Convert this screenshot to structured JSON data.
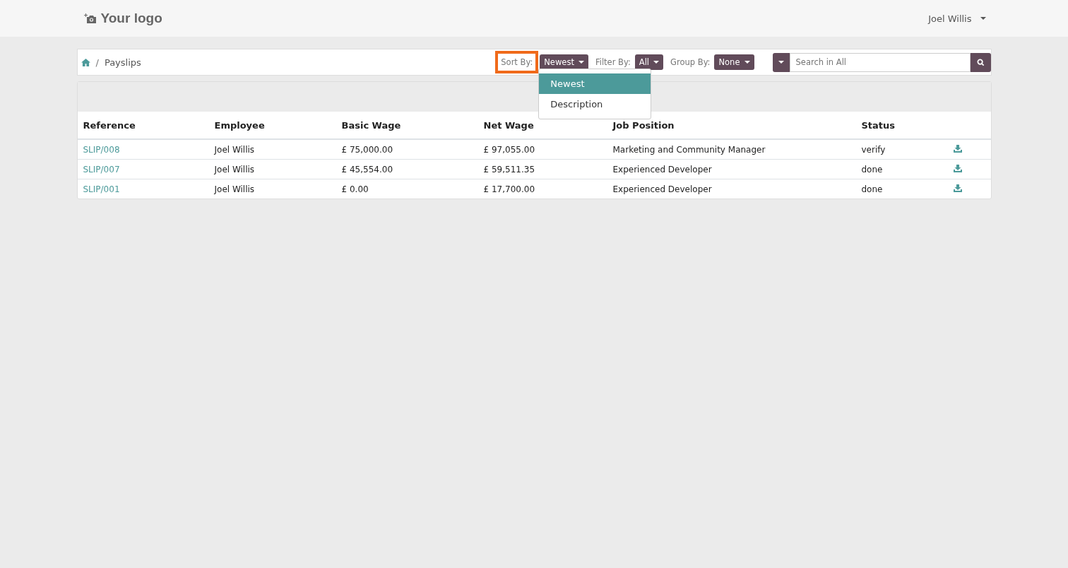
{
  "navbar": {
    "logo": "Your logo",
    "user": "Joel Willis"
  },
  "breadcrumb": {
    "separator": "/",
    "current": "Payslips"
  },
  "controls": [
    {
      "label": "Sort By:",
      "value": "Newest",
      "highlighted": true
    },
    {
      "label": "Filter By:",
      "value": "All",
      "highlighted": false
    },
    {
      "label": "Group By:",
      "value": "None",
      "highlighted": false
    }
  ],
  "search": {
    "placeholder": "Search in All"
  },
  "sort_menu": {
    "items": [
      {
        "label": "Newest",
        "selected": true
      },
      {
        "label": "Description",
        "selected": false
      }
    ]
  },
  "table": {
    "columns": [
      "Reference",
      "Employee",
      "Basic Wage",
      "Net Wage",
      "Job Position",
      "Status"
    ],
    "rows": [
      {
        "cells": [
          "SLIP/008",
          "Joel Willis",
          "£ 75,000.00",
          "£ 97,055.00",
          "Marketing and Community Manager",
          "verify"
        ]
      },
      {
        "cells": [
          "SLIP/007",
          "Joel Willis",
          "£ 45,554.00",
          "£ 59,511.35",
          "Experienced Developer",
          "done"
        ]
      },
      {
        "cells": [
          "SLIP/001",
          "Joel Willis",
          "£ 0.00",
          "£ 17,700.00",
          "Experienced Developer",
          "done"
        ]
      }
    ]
  }
}
